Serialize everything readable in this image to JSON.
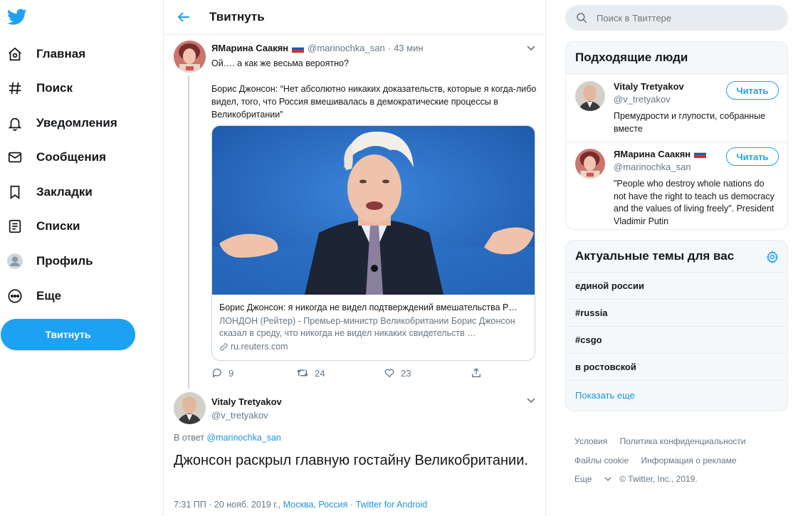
{
  "nav": {
    "items": [
      {
        "label": "Главная",
        "icon": "home-icon"
      },
      {
        "label": "Поиск",
        "icon": "hashtag-icon"
      },
      {
        "label": "Уведомления",
        "icon": "bell-icon"
      },
      {
        "label": "Сообщения",
        "icon": "mail-icon"
      },
      {
        "label": "Закладки",
        "icon": "bookmark-icon"
      },
      {
        "label": "Списки",
        "icon": "list-icon"
      },
      {
        "label": "Профиль",
        "icon": "profile-icon"
      },
      {
        "label": "Еще",
        "icon": "more-icon"
      }
    ],
    "tweet_button": "Твитнуть"
  },
  "header": {
    "title": "Твитнуть"
  },
  "tweet1": {
    "name": "ЯМарина Саакян",
    "handle": "@marinochka_san",
    "separator": "·",
    "time": "43 мин",
    "text_line1": "Ой…. а как же весьма вероятно?",
    "text_line2": "Борис Джонсон: “Нет абсолютно никаких доказательств, которые я когда-либо видел, того, что Россия вмешивалась в демократические процессы в Великобритании”",
    "card": {
      "title": "Борис Джонсон: я никогда не видел подтверждений вмешательства Р…",
      "description": "ЛОНДОН (Рейтер) - Премьер-министр Великобритании Борис Джонсон сказал в среду, что никогда не видел никаких свидетельств …",
      "domain": "ru.reuters.com"
    },
    "actions": {
      "replies": "9",
      "retweets": "24",
      "likes": "23"
    }
  },
  "tweet2": {
    "name": "Vitaly Tretyakov",
    "handle": "@v_tretyakov",
    "reply_prefix": "В ответ",
    "reply_handle": "@marinochka_san",
    "text": "Джонсон раскрыл главную гостайну Великобритании.",
    "timestamp": "7:31 ПП · 20 нояб. 2019 г.,",
    "location": "Москва, Россия",
    "sep": "·",
    "source": "Twitter for Android"
  },
  "search": {
    "placeholder": "Поиск в Твиттере"
  },
  "who_to_follow": {
    "title": "Подходящие люди",
    "items": [
      {
        "name": "Vitaly Tretyakov",
        "handle": "@v_tretyakov",
        "bio": "Премудрости и глупости, собранные вместе",
        "button": "Читать"
      },
      {
        "name": "ЯМарина Саакян",
        "handle": "@marinochka_san",
        "bio": "\"People who destroy whole nations do not have the right to teach us democracy and the values of living freely\". President Vladimir Putin",
        "button": "Читать"
      }
    ]
  },
  "trends": {
    "title": "Актуальные темы для вас",
    "items": [
      "единой россии",
      "#russia",
      "#csgo",
      "в ростовской"
    ],
    "show_more": "Показать еще"
  },
  "footer": {
    "terms": "Условия",
    "privacy": "Политика конфиденциальности",
    "cookies": "Файлы cookie",
    "ads": "Информация о рекламе",
    "more": "Еще",
    "copyright": "© Twitter, Inc., 2019."
  },
  "colors": {
    "accent": "#1da1f2",
    "link": "#1b95e0",
    "text": "#14171a",
    "muted": "#657786",
    "border": "#e6ecf0"
  }
}
